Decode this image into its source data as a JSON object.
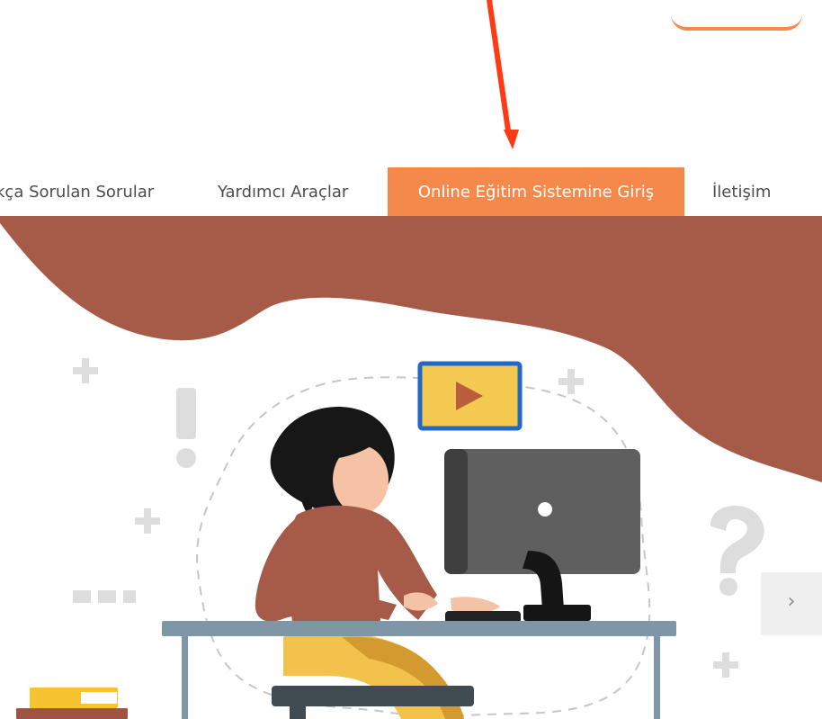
{
  "navigation": {
    "items": [
      {
        "label": "kça Sorulan Sorular"
      },
      {
        "label": "Yardımcı Araçlar"
      },
      {
        "label": "Online Eğitim Sistemine Giriş",
        "active": true
      },
      {
        "label": "İletişim"
      }
    ]
  },
  "hero": {
    "carousel_next_icon": "›"
  },
  "colors": {
    "accent": "#f5894b",
    "arrow": "#ff3b16",
    "hero_wave": "#a65b49",
    "monitor": "#5a5a5a",
    "play_card": "#f4c94f"
  },
  "icons": {
    "annotation": "arrow-down-icon",
    "carousel": "chevron-right-icon",
    "video": "play-icon"
  }
}
